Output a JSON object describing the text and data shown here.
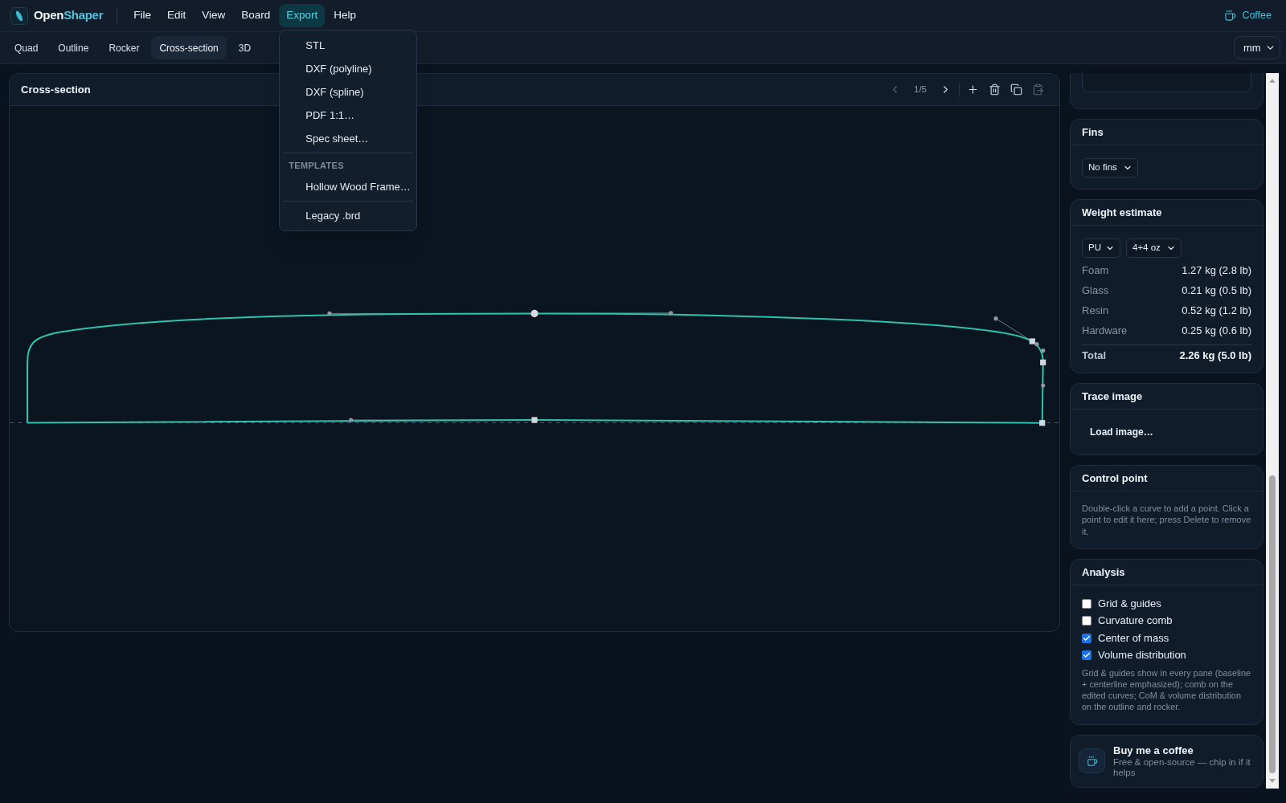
{
  "brand": {
    "first": "Open",
    "second": "Shaper"
  },
  "menus": [
    {
      "label": "File",
      "selected": false
    },
    {
      "label": "Edit",
      "selected": false
    },
    {
      "label": "View",
      "selected": false
    },
    {
      "label": "Board",
      "selected": false
    },
    {
      "label": "Export",
      "selected": true
    },
    {
      "label": "Help",
      "selected": false
    }
  ],
  "coffee_link": {
    "label": "Coffee"
  },
  "tabs": [
    {
      "label": "Quad",
      "selected": false
    },
    {
      "label": "Outline",
      "selected": false
    },
    {
      "label": "Rocker",
      "selected": false
    },
    {
      "label": "Cross-section",
      "selected": true
    },
    {
      "label": "3D",
      "selected": false
    }
  ],
  "unit_select": {
    "value": "mm"
  },
  "export_menu": {
    "items": [
      {
        "kind": "option",
        "label": "STL"
      },
      {
        "kind": "option",
        "label": "DXF (polyline)"
      },
      {
        "kind": "option",
        "label": "DXF (spline)"
      },
      {
        "kind": "option",
        "label": "PDF 1:1…"
      },
      {
        "kind": "option",
        "label": "Spec sheet…"
      },
      {
        "kind": "separator"
      },
      {
        "kind": "heading",
        "label": "TEMPLATES"
      },
      {
        "kind": "option",
        "label": "Hollow Wood Frame…"
      },
      {
        "kind": "separator"
      },
      {
        "kind": "option",
        "label": "Legacy .brd"
      }
    ]
  },
  "canvas_panel": {
    "title": "Cross-section",
    "pager": {
      "prev": {
        "disabled": true
      },
      "page": "1/5",
      "next": {
        "disabled": false
      }
    },
    "actions": [
      {
        "kind": "add",
        "disabled": false
      },
      {
        "kind": "delete",
        "disabled": false
      },
      {
        "kind": "duplicate",
        "disabled": false
      },
      {
        "kind": "paste",
        "disabled": true
      }
    ]
  },
  "side_panel": {
    "fins": {
      "title": "Fins",
      "select": "No fins"
    },
    "weight_estimate": {
      "title": "Weight estimate",
      "selects": [
        "PU",
        "4+4 oz"
      ],
      "rows": [
        {
          "label": "Foam",
          "value": "1.27 kg (2.8 lb)"
        },
        {
          "label": "Glass",
          "value": "0.21 kg (0.5 lb)"
        },
        {
          "label": "Resin",
          "value": "0.52 kg (1.2 lb)"
        },
        {
          "label": "Hardware",
          "value": "0.25 kg (0.6 lb)"
        }
      ],
      "total": {
        "label": "Total",
        "value": "2.26 kg (5.0 lb)"
      }
    },
    "trace_image": {
      "title": "Trace image",
      "button": "Load image…"
    },
    "control_point": {
      "title": "Control point",
      "text": "Double-click a curve to add a point. Click a point to edit it here; press Delete to remove it."
    },
    "analysis": {
      "title": "Analysis",
      "options": [
        {
          "label": "Grid & guides",
          "checked": false
        },
        {
          "label": "Curvature comb",
          "checked": false
        },
        {
          "label": "Center of mass",
          "checked": true
        },
        {
          "label": "Volume distribution",
          "checked": true
        }
      ],
      "note": "Grid & guides show in every pane (baseline + centerline emphasized); comb on the edited curves; CoM & volume distribution on the outline and rocker."
    },
    "support_card": {
      "title": "Buy me a coffee",
      "text": "Free & open-source — chip in if it helps"
    }
  }
}
